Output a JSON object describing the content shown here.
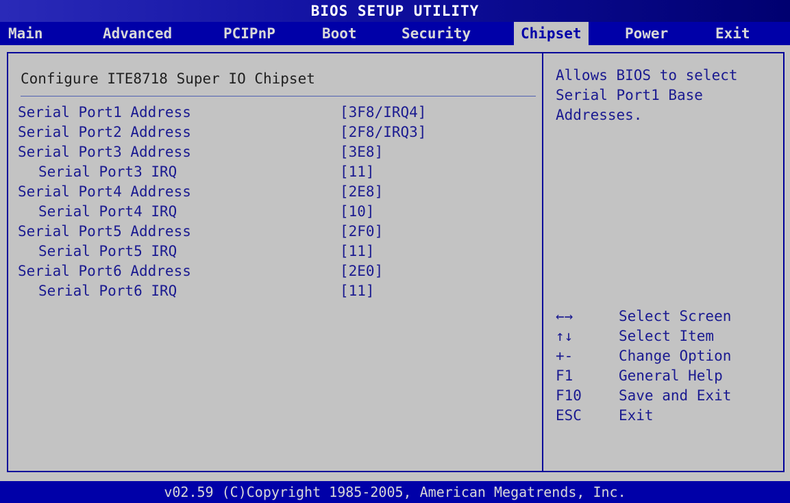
{
  "window": {
    "title": "BIOS SETUP UTILITY"
  },
  "menu": {
    "items": [
      {
        "label": "Main"
      },
      {
        "label": "Advanced"
      },
      {
        "label": "PCIPnP"
      },
      {
        "label": "Boot"
      },
      {
        "label": "Security"
      },
      {
        "label": "Chipset"
      },
      {
        "label": "Power"
      },
      {
        "label": "Exit"
      }
    ]
  },
  "main": {
    "section_title": "Configure ITE8718 Super IO Chipset",
    "settings": [
      {
        "label": "Serial Port1 Address",
        "value": "[3F8/IRQ4]"
      },
      {
        "label": "Serial Port2 Address",
        "value": "[2F8/IRQ3]"
      },
      {
        "label": "Serial Port3 Address",
        "value": "[3E8]"
      },
      {
        "label": "Serial Port3 IRQ",
        "value": "[11]"
      },
      {
        "label": "Serial Port4 Address",
        "value": "[2E8]"
      },
      {
        "label": "Serial Port4 IRQ",
        "value": "[10]"
      },
      {
        "label": "Serial Port5 Address",
        "value": "[2F0]"
      },
      {
        "label": "Serial Port5 IRQ",
        "value": "[11]"
      },
      {
        "label": "Serial Port6 Address",
        "value": "[2E0]"
      },
      {
        "label": "Serial Port6 IRQ",
        "value": "[11]"
      }
    ]
  },
  "help": {
    "lines": [
      "Allows BIOS to select",
      "Serial Port1 Base",
      "Addresses."
    ],
    "keys": [
      {
        "key": "←→",
        "desc": "Select Screen"
      },
      {
        "key": "↑↓",
        "desc": "Select Item"
      },
      {
        "key": "+-",
        "desc": "Change Option"
      },
      {
        "key": "F1",
        "desc": "General Help"
      },
      {
        "key": "F10",
        "desc": "Save and Exit"
      },
      {
        "key": "ESC",
        "desc": "Exit"
      }
    ]
  },
  "footer": {
    "copyright": "v02.59 (C)Copyright 1985-2005, American Megatrends, Inc."
  },
  "colors": {
    "menu_bar": "#0000a8",
    "panel_background": "#c3c3c3",
    "setting_text": "#1a1a90",
    "border": "#00009a"
  }
}
